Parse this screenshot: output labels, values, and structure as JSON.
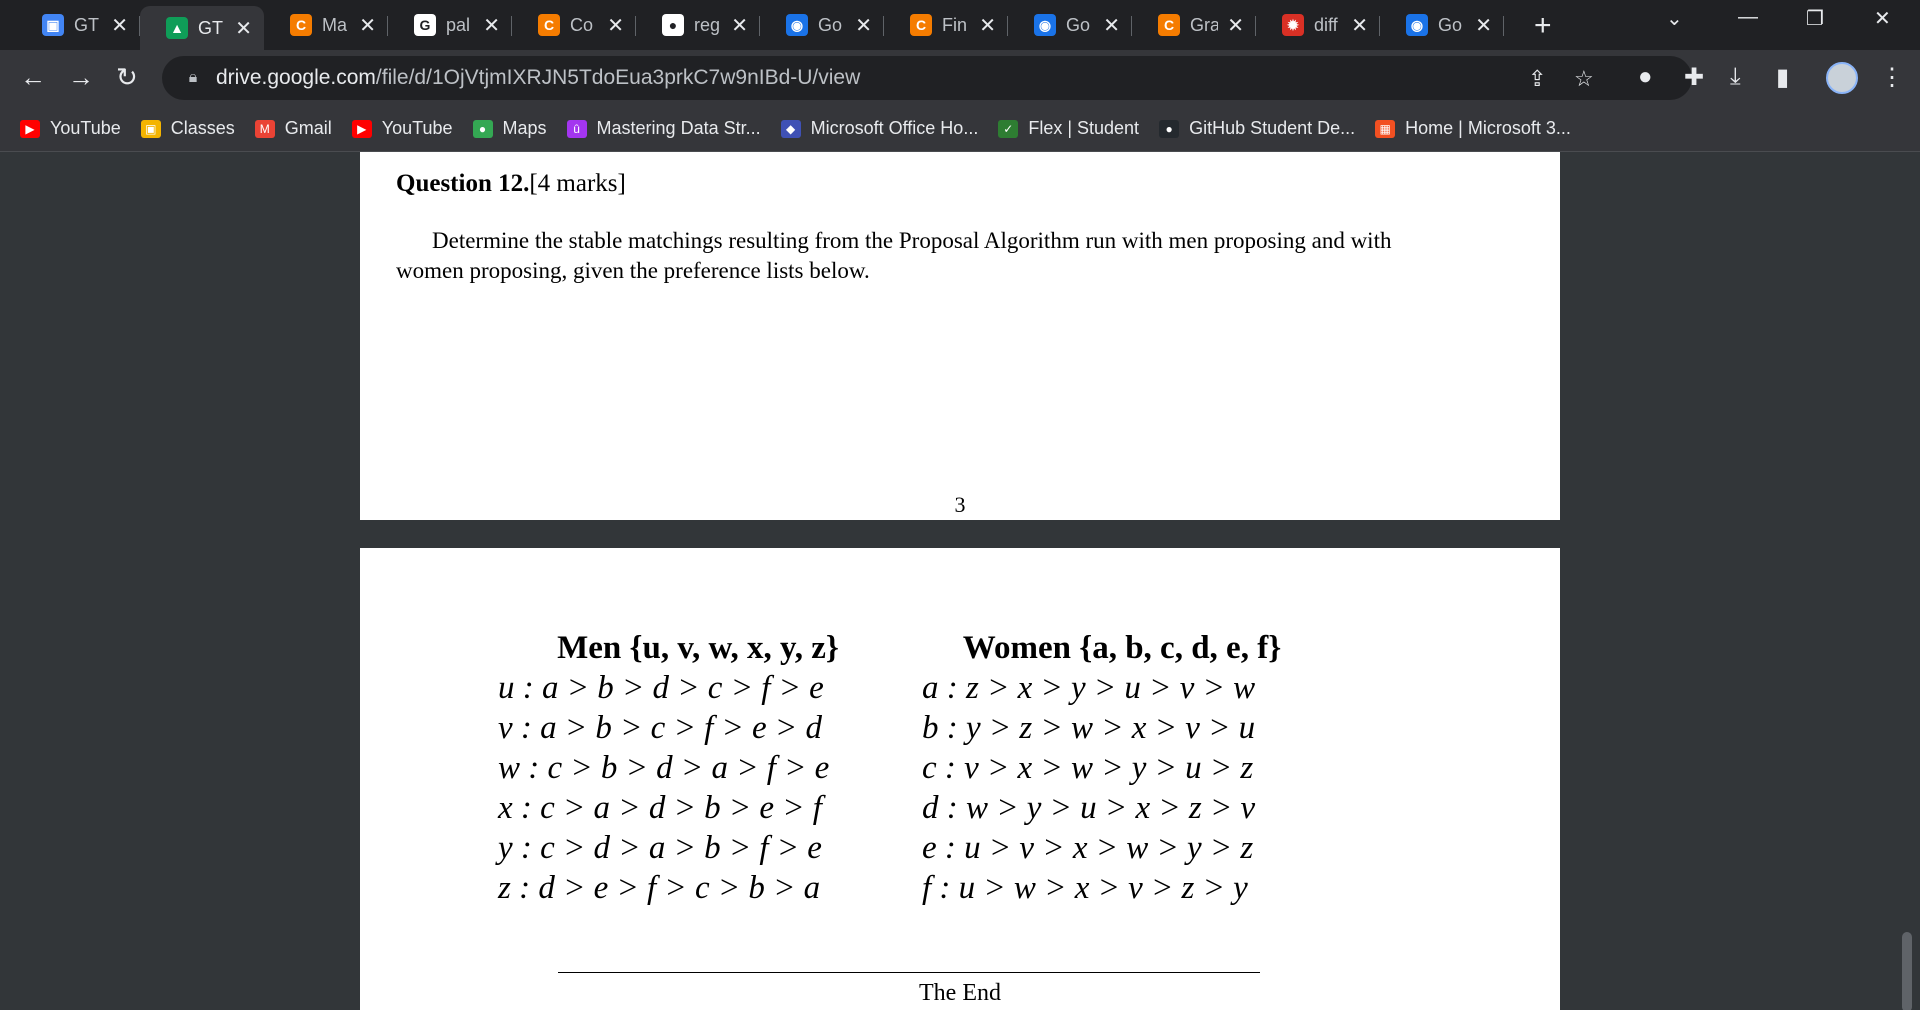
{
  "tabs": [
    {
      "title": "GT",
      "fav_color": "#4285f4",
      "fav_glyph": "▣"
    },
    {
      "title": "GT",
      "fav_color": "#0f9d58",
      "fav_glyph": "▲",
      "active": true
    },
    {
      "title": "Ma",
      "fav_color": "#f57c00",
      "fav_glyph": "C"
    },
    {
      "title": "pal",
      "fav_color": "#ffffff",
      "fav_glyph": "G"
    },
    {
      "title": "Co",
      "fav_color": "#f57c00",
      "fav_glyph": "C"
    },
    {
      "title": "reg",
      "fav_color": "#ffffff",
      "fav_glyph": "●"
    },
    {
      "title": "Go",
      "fav_color": "#1a73e8",
      "fav_glyph": "◉"
    },
    {
      "title": "Fin",
      "fav_color": "#f57c00",
      "fav_glyph": "C"
    },
    {
      "title": "Go",
      "fav_color": "#1a73e8",
      "fav_glyph": "◉"
    },
    {
      "title": "Gra",
      "fav_color": "#f57c00",
      "fav_glyph": "C"
    },
    {
      "title": "diff",
      "fav_color": "#d93025",
      "fav_glyph": "✹"
    },
    {
      "title": "Go",
      "fav_color": "#1a73e8",
      "fav_glyph": "◉"
    }
  ],
  "address": {
    "host": "drive.google.com",
    "path": "/file/d/1OjVtjmIXRJN5TdoEua3prkC7w9nIBd-U/view"
  },
  "bookmarks": [
    {
      "label": "YouTube",
      "icon": "youtube-icon",
      "color": "#ff0000",
      "glyph": "▶"
    },
    {
      "label": "Classes",
      "icon": "classroom-icon",
      "color": "#f4b400",
      "glyph": "▣"
    },
    {
      "label": "Gmail",
      "icon": "gmail-icon",
      "color": "#ea4335",
      "glyph": "M"
    },
    {
      "label": "YouTube",
      "icon": "youtube-icon",
      "color": "#ff0000",
      "glyph": "▶"
    },
    {
      "label": "Maps",
      "icon": "maps-icon",
      "color": "#34a853",
      "glyph": "●"
    },
    {
      "label": "Mastering Data Str...",
      "icon": "udemy-icon",
      "color": "#a435f0",
      "glyph": "û"
    },
    {
      "label": "Microsoft Office Ho...",
      "icon": "office-icon",
      "color": "#3f51b5",
      "glyph": "◆"
    },
    {
      "label": "Flex | Student",
      "icon": "flex-icon",
      "color": "#2e7d32",
      "glyph": "✓"
    },
    {
      "label": "GitHub Student De...",
      "icon": "github-icon",
      "color": "#24292e",
      "glyph": "●"
    },
    {
      "label": "Home | Microsoft 3...",
      "icon": "microsoft-icon",
      "color": "#f25022",
      "glyph": "▦"
    }
  ],
  "document": {
    "q_number": "Question 12.",
    "q_marks": "[4 marks]",
    "q_body": "Determine the stable matchings resulting from the Proposal Algorithm run with men proposing and with women proposing, given the preference lists below.",
    "page_number": "3",
    "men_header": "Men {u, v, w, x, y, z}",
    "women_header": "Women {a, b, c, d, e, f}",
    "men": [
      "u : a > b > d > c > f > e",
      "v : a > b > c > f > e > d",
      "w : c > b > d > a > f > e",
      "x : c > a > d > b > e > f",
      "y : c > d > a > b > f > e",
      "z : d > e > f > c > b > a"
    ],
    "women": [
      "a : z > x > y > u > v > w",
      "b : y > z > w > x > v > u",
      "c : v > x > w > y > u > z",
      "d : w > y > u > x > z > v",
      "e : u > v > x > w > y > z",
      "f : u > w > x > v > z > y"
    ],
    "end_text": "The End"
  }
}
